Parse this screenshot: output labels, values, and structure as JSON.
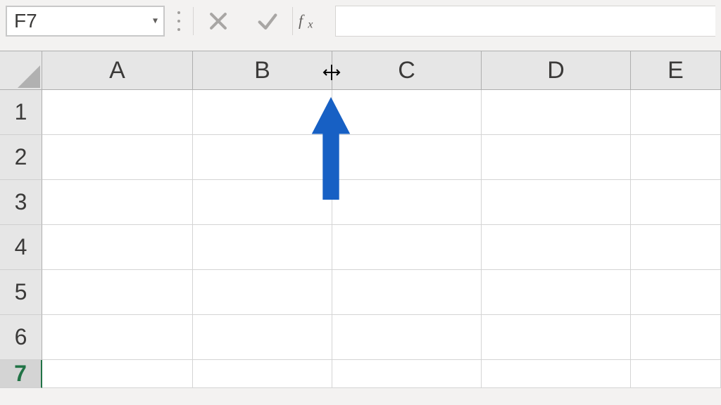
{
  "name_box": {
    "value": "F7"
  },
  "formula_bar": {
    "cancel_label": "",
    "enter_label": "",
    "fx_label": "fx",
    "value": ""
  },
  "columns": [
    "A",
    "B",
    "C",
    "D",
    "E"
  ],
  "rows": [
    "1",
    "2",
    "3",
    "4",
    "5",
    "6",
    "7"
  ],
  "selected_row": "7",
  "annotation": {
    "arrow_color": "#1760c4",
    "direction": "up"
  }
}
